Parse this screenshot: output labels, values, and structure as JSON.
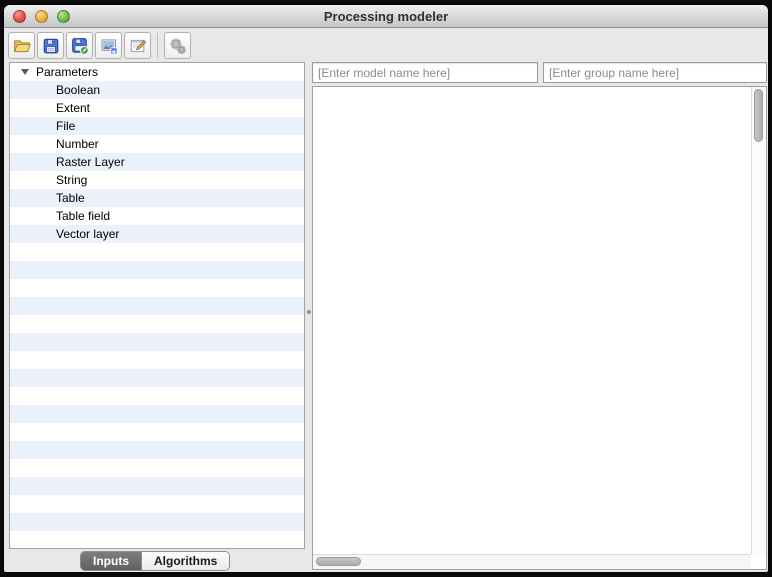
{
  "window": {
    "title": "Processing modeler",
    "traffic_lights": {
      "close": "red",
      "minimize": "yellow",
      "zoom": "green"
    }
  },
  "toolbar": {
    "buttons": [
      {
        "id": "open-model",
        "icon": "folder-open-icon",
        "disabled": false
      },
      {
        "id": "save-model",
        "icon": "floppy-save-icon",
        "disabled": false
      },
      {
        "id": "save-model-as",
        "icon": "floppy-save-as-icon",
        "disabled": false
      },
      {
        "id": "export-as-image",
        "icon": "export-image-icon",
        "disabled": false
      },
      {
        "id": "edit-model-help",
        "icon": "edit-help-icon",
        "disabled": false
      },
      {
        "id": "run-model",
        "icon": "gears-icon",
        "disabled": true
      }
    ]
  },
  "sidebar": {
    "tree": {
      "root_label": "Parameters",
      "root_expanded": true,
      "items": [
        {
          "label": "Boolean"
        },
        {
          "label": "Extent"
        },
        {
          "label": "File"
        },
        {
          "label": "Number"
        },
        {
          "label": "Raster Layer"
        },
        {
          "label": "String"
        },
        {
          "label": "Table"
        },
        {
          "label": "Table field"
        },
        {
          "label": "Vector layer"
        }
      ]
    },
    "tabs": {
      "inputs_label": "Inputs",
      "algorithms_label": "Algorithms",
      "selected": "Inputs"
    }
  },
  "main": {
    "model_name_value": "[Enter model name here]",
    "group_name_value": "[Enter group name here]",
    "canvas_empty": true
  },
  "colors": {
    "row_stripe_blue": "#ebf1fb",
    "window_background": "#e8e8e8",
    "tab_selected_background": "#6e6e6e",
    "input_text_gray": "#8a8a8a",
    "traffic_red": "#e05247",
    "traffic_yellow": "#f0b23e",
    "traffic_green": "#6cbb4c"
  }
}
